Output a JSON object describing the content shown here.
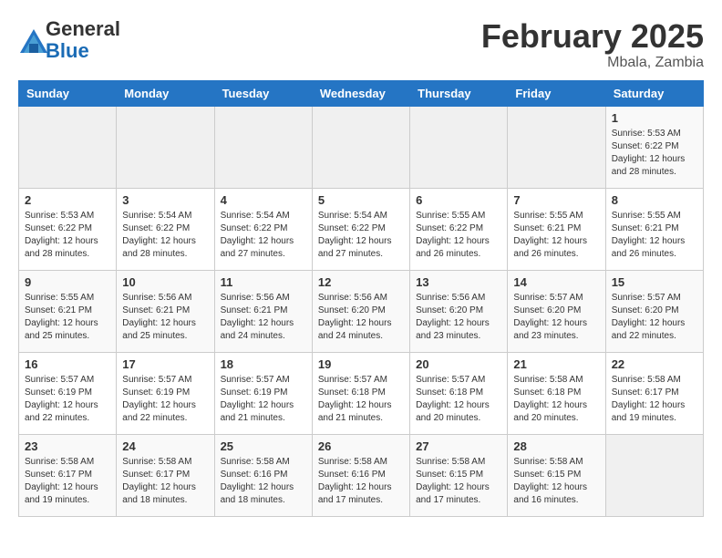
{
  "header": {
    "logo_general": "General",
    "logo_blue": "Blue",
    "title": "February 2025",
    "subtitle": "Mbala, Zambia"
  },
  "calendar": {
    "days_of_week": [
      "Sunday",
      "Monday",
      "Tuesday",
      "Wednesday",
      "Thursday",
      "Friday",
      "Saturday"
    ],
    "weeks": [
      [
        {
          "day": "",
          "info": ""
        },
        {
          "day": "",
          "info": ""
        },
        {
          "day": "",
          "info": ""
        },
        {
          "day": "",
          "info": ""
        },
        {
          "day": "",
          "info": ""
        },
        {
          "day": "",
          "info": ""
        },
        {
          "day": "1",
          "info": "Sunrise: 5:53 AM\nSunset: 6:22 PM\nDaylight: 12 hours and 28 minutes."
        }
      ],
      [
        {
          "day": "2",
          "info": "Sunrise: 5:53 AM\nSunset: 6:22 PM\nDaylight: 12 hours and 28 minutes."
        },
        {
          "day": "3",
          "info": "Sunrise: 5:54 AM\nSunset: 6:22 PM\nDaylight: 12 hours and 28 minutes."
        },
        {
          "day": "4",
          "info": "Sunrise: 5:54 AM\nSunset: 6:22 PM\nDaylight: 12 hours and 27 minutes."
        },
        {
          "day": "5",
          "info": "Sunrise: 5:54 AM\nSunset: 6:22 PM\nDaylight: 12 hours and 27 minutes."
        },
        {
          "day": "6",
          "info": "Sunrise: 5:55 AM\nSunset: 6:22 PM\nDaylight: 12 hours and 26 minutes."
        },
        {
          "day": "7",
          "info": "Sunrise: 5:55 AM\nSunset: 6:21 PM\nDaylight: 12 hours and 26 minutes."
        },
        {
          "day": "8",
          "info": "Sunrise: 5:55 AM\nSunset: 6:21 PM\nDaylight: 12 hours and 26 minutes."
        }
      ],
      [
        {
          "day": "9",
          "info": "Sunrise: 5:55 AM\nSunset: 6:21 PM\nDaylight: 12 hours and 25 minutes."
        },
        {
          "day": "10",
          "info": "Sunrise: 5:56 AM\nSunset: 6:21 PM\nDaylight: 12 hours and 25 minutes."
        },
        {
          "day": "11",
          "info": "Sunrise: 5:56 AM\nSunset: 6:21 PM\nDaylight: 12 hours and 24 minutes."
        },
        {
          "day": "12",
          "info": "Sunrise: 5:56 AM\nSunset: 6:20 PM\nDaylight: 12 hours and 24 minutes."
        },
        {
          "day": "13",
          "info": "Sunrise: 5:56 AM\nSunset: 6:20 PM\nDaylight: 12 hours and 23 minutes."
        },
        {
          "day": "14",
          "info": "Sunrise: 5:57 AM\nSunset: 6:20 PM\nDaylight: 12 hours and 23 minutes."
        },
        {
          "day": "15",
          "info": "Sunrise: 5:57 AM\nSunset: 6:20 PM\nDaylight: 12 hours and 22 minutes."
        }
      ],
      [
        {
          "day": "16",
          "info": "Sunrise: 5:57 AM\nSunset: 6:19 PM\nDaylight: 12 hours and 22 minutes."
        },
        {
          "day": "17",
          "info": "Sunrise: 5:57 AM\nSunset: 6:19 PM\nDaylight: 12 hours and 22 minutes."
        },
        {
          "day": "18",
          "info": "Sunrise: 5:57 AM\nSunset: 6:19 PM\nDaylight: 12 hours and 21 minutes."
        },
        {
          "day": "19",
          "info": "Sunrise: 5:57 AM\nSunset: 6:18 PM\nDaylight: 12 hours and 21 minutes."
        },
        {
          "day": "20",
          "info": "Sunrise: 5:57 AM\nSunset: 6:18 PM\nDaylight: 12 hours and 20 minutes."
        },
        {
          "day": "21",
          "info": "Sunrise: 5:58 AM\nSunset: 6:18 PM\nDaylight: 12 hours and 20 minutes."
        },
        {
          "day": "22",
          "info": "Sunrise: 5:58 AM\nSunset: 6:17 PM\nDaylight: 12 hours and 19 minutes."
        }
      ],
      [
        {
          "day": "23",
          "info": "Sunrise: 5:58 AM\nSunset: 6:17 PM\nDaylight: 12 hours and 19 minutes."
        },
        {
          "day": "24",
          "info": "Sunrise: 5:58 AM\nSunset: 6:17 PM\nDaylight: 12 hours and 18 minutes."
        },
        {
          "day": "25",
          "info": "Sunrise: 5:58 AM\nSunset: 6:16 PM\nDaylight: 12 hours and 18 minutes."
        },
        {
          "day": "26",
          "info": "Sunrise: 5:58 AM\nSunset: 6:16 PM\nDaylight: 12 hours and 17 minutes."
        },
        {
          "day": "27",
          "info": "Sunrise: 5:58 AM\nSunset: 6:15 PM\nDaylight: 12 hours and 17 minutes."
        },
        {
          "day": "28",
          "info": "Sunrise: 5:58 AM\nSunset: 6:15 PM\nDaylight: 12 hours and 16 minutes."
        },
        {
          "day": "",
          "info": ""
        }
      ]
    ]
  }
}
